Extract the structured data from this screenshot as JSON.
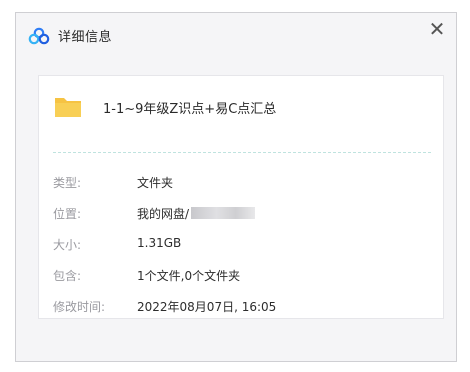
{
  "dialog": {
    "title": "详细信息",
    "close_glyph": "✕",
    "logo_icon": "baidu-netdisk-logo-icon"
  },
  "file": {
    "icon": "folder-icon",
    "name": "1-1~9年级Z识点+易C点汇总"
  },
  "details": [
    {
      "label": "类型:",
      "value": "文件夹"
    },
    {
      "label": "位置:",
      "value": "我的网盘/"
    },
    {
      "label": "大小:",
      "value": "1.31GB"
    },
    {
      "label": "包含:",
      "value": "1个文件,0个文件夹"
    },
    {
      "label": "修改时间:",
      "value": "2022年08月07日, 16:05"
    }
  ],
  "colors": {
    "accent_blue": "#2f7df6",
    "folder_yellow": "#f6c343",
    "separator_teal": "#bfe3df"
  }
}
